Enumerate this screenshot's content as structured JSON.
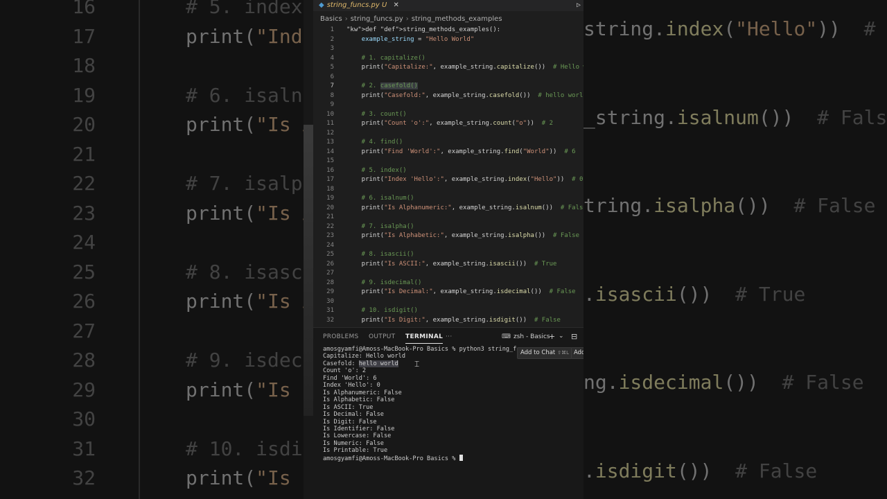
{
  "background_code": {
    "left": [
      {
        "num": "16",
        "code": "# 5. index()",
        "kind": "comment"
      },
      {
        "num": "17",
        "code": "print(\"Index 'Hello':\", example_string.index(\"Hello\"))  # 0",
        "kind": "code"
      },
      {
        "num": "18",
        "code": "",
        "kind": "code"
      },
      {
        "num": "19",
        "code": "# 6. isalnum()",
        "kind": "comment"
      },
      {
        "num": "20",
        "code": "print(\"Is Alphanumeric:\", example_string.isalnum())  # False",
        "kind": "code"
      },
      {
        "num": "21",
        "code": "",
        "kind": "code"
      },
      {
        "num": "22",
        "code": "# 7. isalpha()",
        "kind": "comment"
      },
      {
        "num": "23",
        "code": "print(\"Is Alphabetic:\", example_string.isalpha())  # False",
        "kind": "code"
      },
      {
        "num": "24",
        "code": "",
        "kind": "code"
      },
      {
        "num": "25",
        "code": "# 8. isascii()",
        "kind": "comment"
      },
      {
        "num": "26",
        "code": "print(\"Is ASCII:\", example_string.isascii())  # True",
        "kind": "code"
      },
      {
        "num": "27",
        "code": "",
        "kind": "code"
      },
      {
        "num": "28",
        "code": "# 9. isdecimal()",
        "kind": "comment"
      },
      {
        "num": "29",
        "code": "print(\"Is Decimal:\", example_string.isdecimal())  # False",
        "kind": "code"
      },
      {
        "num": "30",
        "code": "",
        "kind": "code"
      },
      {
        "num": "31",
        "code": "# 10. isdigit()",
        "kind": "comment"
      },
      {
        "num": "32",
        "code": "print(\"Is Digit:\", example_string.isdigit())  # False",
        "kind": "code"
      }
    ],
    "right": [
      {
        "code": "string.index(\"Hello\"))  # 0"
      },
      {
        "code": ""
      },
      {
        "code": ""
      },
      {
        "code": "_string.isalnum())  # False"
      },
      {
        "code": ""
      },
      {
        "code": ""
      },
      {
        "code": "tring.isalpha())  # False"
      },
      {
        "code": ""
      },
      {
        "code": ""
      },
      {
        "code": ".isascii())  # True"
      },
      {
        "code": ""
      },
      {
        "code": ""
      },
      {
        "code": "ng.isdecimal())  # False"
      },
      {
        "code": ""
      },
      {
        "code": ""
      },
      {
        "code": ".isdigit())  # False"
      }
    ]
  },
  "tab": {
    "filename": "string_funcs.py",
    "status": "U",
    "close": "✕",
    "run": "▷"
  },
  "breadcrumb": {
    "folder": "Basics",
    "file": "string_funcs.py",
    "symbol": "string_methods_examples"
  },
  "code_lines": [
    {
      "n": "1",
      "t": "def string_methods_examples():"
    },
    {
      "n": "2",
      "t": "    example_string = \"Hello World\""
    },
    {
      "n": "3",
      "t": ""
    },
    {
      "n": "4",
      "t": "    # 1. capitalize()"
    },
    {
      "n": "5",
      "t": "    print(\"Capitalize:\", example_string.capitalize())  # Hello world"
    },
    {
      "n": "6",
      "t": ""
    },
    {
      "n": "7",
      "t": "    # 2. casefold()"
    },
    {
      "n": "8",
      "t": "    print(\"Casefold:\", example_string.casefold())  # hello world"
    },
    {
      "n": "9",
      "t": ""
    },
    {
      "n": "10",
      "t": "    # 3. count()"
    },
    {
      "n": "11",
      "t": "    print(\"Count 'o':\", example_string.count(\"o\"))  # 2"
    },
    {
      "n": "12",
      "t": ""
    },
    {
      "n": "13",
      "t": "    # 4. find()"
    },
    {
      "n": "14",
      "t": "    print(\"Find 'World':\", example_string.find(\"World\"))  # 6"
    },
    {
      "n": "15",
      "t": ""
    },
    {
      "n": "16",
      "t": "    # 5. index()"
    },
    {
      "n": "17",
      "t": "    print(\"Index 'Hello':\", example_string.index(\"Hello\"))  # 0"
    },
    {
      "n": "18",
      "t": ""
    },
    {
      "n": "19",
      "t": "    # 6. isalnum()"
    },
    {
      "n": "20",
      "t": "    print(\"Is Alphanumeric:\", example_string.isalnum())  # False"
    },
    {
      "n": "21",
      "t": ""
    },
    {
      "n": "22",
      "t": "    # 7. isalpha()"
    },
    {
      "n": "23",
      "t": "    print(\"Is Alphabetic:\", example_string.isalpha())  # False"
    },
    {
      "n": "24",
      "t": ""
    },
    {
      "n": "25",
      "t": "    # 8. isascii()"
    },
    {
      "n": "26",
      "t": "    print(\"Is ASCII:\", example_string.isascii())  # True"
    },
    {
      "n": "27",
      "t": ""
    },
    {
      "n": "28",
      "t": "    # 9. isdecimal()"
    },
    {
      "n": "29",
      "t": "    print(\"Is Decimal:\", example_string.isdecimal())  # False"
    },
    {
      "n": "30",
      "t": ""
    },
    {
      "n": "31",
      "t": "    # 10. isdigit()"
    },
    {
      "n": "32",
      "t": "    print(\"Is Digit:\", example_string.isdigit())  # False"
    }
  ],
  "active_line": "7",
  "panel": {
    "tabs": [
      "PROBLEMS",
      "OUTPUT",
      "TERMINAL"
    ],
    "active_tab": "TERMINAL",
    "more": "···",
    "terminal_name": "zsh - Basics",
    "add": "+",
    "dropdown": "⌄",
    "split": "⊟",
    "add_to_chat": "Add to Chat",
    "add_to_chat_kbd": "⇧⌘L",
    "add_other": "Add"
  },
  "terminal_lines": [
    "amosgyamfi@Amoss-MacBook-Pro Basics % python3 string_funcs.py",
    "Capitalize: Hello world",
    "Casefold: hello world",
    "Count 'o': 2",
    "Find 'World': 6",
    "Index 'Hello': 0",
    "Is Alphanumeric: False",
    "Is Alphabetic: False",
    "Is ASCII: True",
    "Is Decimal: False",
    "Is Digit: False",
    "Is Identifier: False",
    "Is Lowercase: False",
    "Is Numeric: False",
    "Is Printable: True",
    "amosgyamfi@Amoss-MacBook-Pro Basics % "
  ]
}
